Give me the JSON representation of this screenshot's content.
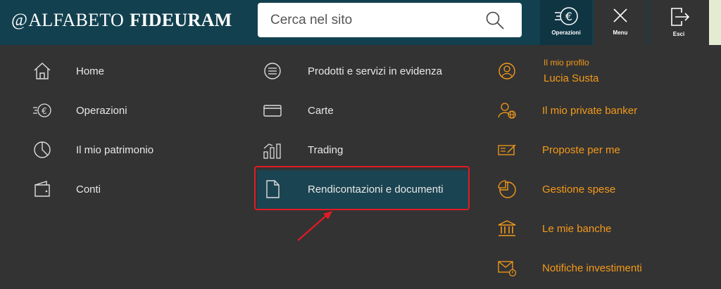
{
  "header": {
    "logo_prefix": "@",
    "logo_name": "ALFABETO",
    "logo_brand": "FIDEURAM",
    "search_placeholder": "Cerca nel sito",
    "actions": [
      {
        "label": "Operazioni",
        "icon": "euro-transfer-icon",
        "active": true
      },
      {
        "label": "Menu",
        "icon": "close-icon",
        "active": false
      },
      {
        "label": "Esci",
        "icon": "logout-icon",
        "active": false
      }
    ]
  },
  "menu": {
    "col1": [
      {
        "label": "Home",
        "icon": "home-icon"
      },
      {
        "label": "Operazioni",
        "icon": "euro-transfer-icon"
      },
      {
        "label": "Il mio patrimonio",
        "icon": "pie-chart-icon"
      },
      {
        "label": "Conti",
        "icon": "wallet-icon"
      }
    ],
    "col2": [
      {
        "label": "Prodotti e servizi in evidenza",
        "icon": "list-circle-icon"
      },
      {
        "label": "Carte",
        "icon": "credit-card-icon"
      },
      {
        "label": "Trading",
        "icon": "bar-chart-icon"
      },
      {
        "label": "Rendicontazioni e documenti",
        "icon": "document-icon",
        "highlighted": true
      }
    ],
    "col3": {
      "profile": {
        "caption": "Il mio profilo",
        "name": "Lucia Susta",
        "icon": "user-circle-icon"
      },
      "items": [
        {
          "label": "Il mio private banker",
          "icon": "banker-globe-icon"
        },
        {
          "label": "Proposte per me",
          "icon": "proposal-icon"
        },
        {
          "label": "Gestione spese",
          "icon": "expense-pie-icon"
        },
        {
          "label": "Le mie banche",
          "icon": "bank-icon"
        },
        {
          "label": "Notifiche investimenti",
          "icon": "notification-mail-icon"
        }
      ]
    }
  },
  "colors": {
    "header_bg": "#12404f",
    "menu_bg": "#333333",
    "accent_orange": "#f59a19",
    "highlight_bg": "#1b4452",
    "annotation_red": "#e01b24"
  }
}
